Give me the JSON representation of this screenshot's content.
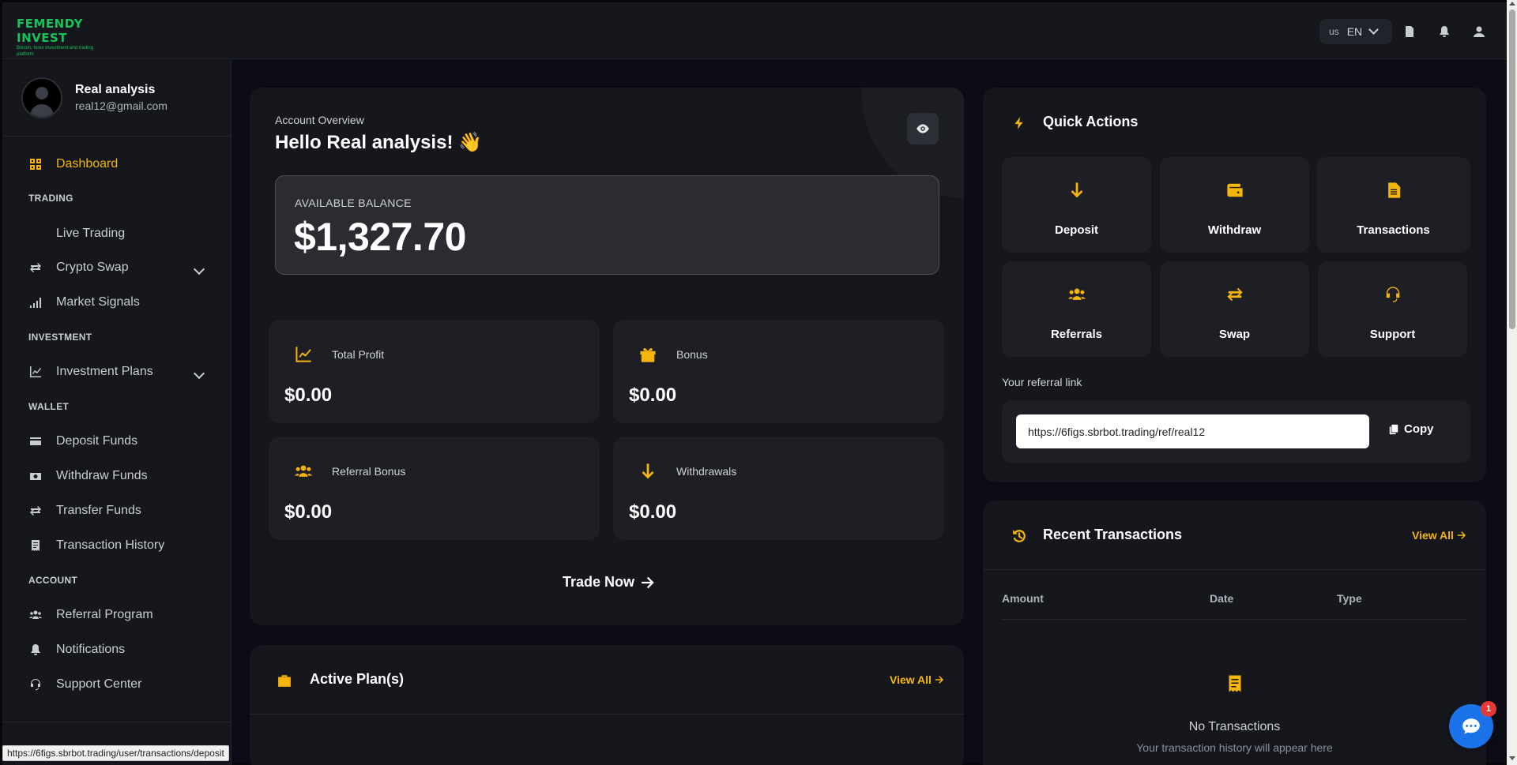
{
  "brand": {
    "logo_text": "FEMENDY INVEST",
    "logo_tagline": "Bitcoin, forex investment and trading platform",
    "accent_color": "#f5b50a"
  },
  "topbar": {
    "language_flag": "us",
    "language_code": "EN",
    "icons": [
      "document-icon",
      "bell-icon",
      "user-icon"
    ]
  },
  "profile": {
    "name": "Real analysis",
    "email": "real12@gmail.com"
  },
  "sidebar": {
    "dashboard": "Dashboard",
    "section_trading": "TRADING",
    "live_trading": "Live Trading",
    "crypto_swap": "Crypto Swap",
    "market_signals": "Market Signals",
    "section_investment": "INVESTMENT",
    "investment_plans": "Investment Plans",
    "section_wallet": "WALLET",
    "deposit_funds": "Deposit Funds",
    "withdraw_funds": "Withdraw Funds",
    "transfer_funds": "Transfer Funds",
    "transaction_history": "Transaction History",
    "section_account": "ACCOUNT",
    "referral_program": "Referral Program",
    "notifications": "Notifications",
    "support_center": "Support Center"
  },
  "overview": {
    "label": "Account Overview",
    "greeting": "Hello Real analysis! 👋",
    "balance_label": "AVAILABLE BALANCE",
    "balance_value": "$1,327.70",
    "stats": [
      {
        "label": "Total Profit",
        "value": "$0.00",
        "icon": "chart-line-icon"
      },
      {
        "label": "Bonus",
        "value": "$0.00",
        "icon": "gift-icon"
      },
      {
        "label": "Referral Bonus",
        "value": "$0.00",
        "icon": "users-icon"
      },
      {
        "label": "Withdrawals",
        "value": "$0.00",
        "icon": "arrow-down-icon"
      }
    ],
    "trade_now": "Trade Now"
  },
  "active_plans": {
    "title": "Active Plan(s)",
    "view_all": "View All"
  },
  "quick_actions": {
    "title": "Quick Actions",
    "items": [
      {
        "label": "Deposit",
        "icon": "arrow-down-icon"
      },
      {
        "label": "Withdraw",
        "icon": "wallet-icon"
      },
      {
        "label": "Transactions",
        "icon": "file-icon"
      },
      {
        "label": "Referrals",
        "icon": "users-icon"
      },
      {
        "label": "Swap",
        "icon": "swap-icon"
      },
      {
        "label": "Support",
        "icon": "headset-icon"
      }
    ],
    "referral_label": "Your referral link",
    "referral_link": "https://6figs.sbrbot.trading/ref/real12",
    "copy_label": "Copy"
  },
  "recent_transactions": {
    "title": "Recent Transactions",
    "view_all": "View All",
    "columns": [
      "Amount",
      "Date",
      "Type"
    ],
    "empty_title": "No Transactions",
    "empty_subtitle": "Your transaction history will appear here"
  },
  "chat": {
    "badge_count": "1"
  },
  "status_bar": {
    "url": "https://6figs.sbrbot.trading/user/transactions/deposit"
  }
}
